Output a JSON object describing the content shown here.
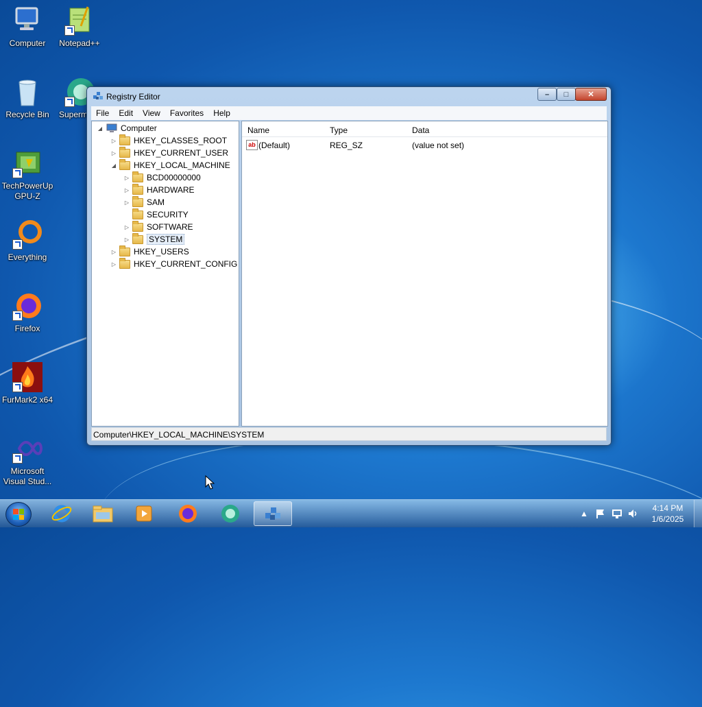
{
  "desktop": {
    "icons": [
      {
        "label": "Computer",
        "icon": "computer-icon"
      },
      {
        "label": "Notepad++",
        "icon": "notepadpp-icon"
      },
      {
        "label": "Recycle Bin",
        "icon": "recycle-bin-icon"
      },
      {
        "label": "Superm",
        "icon": "supermium-icon"
      },
      {
        "label": "TechPowerUp GPU-Z",
        "icon": "gpuz-icon"
      },
      {
        "label": "Everything",
        "icon": "everything-icon"
      },
      {
        "label": "Firefox",
        "icon": "firefox-icon"
      },
      {
        "label": "FurMark2 x64",
        "icon": "furmark-icon"
      },
      {
        "label": "Microsoft Visual Stud...",
        "icon": "visual-studio-icon"
      }
    ]
  },
  "window": {
    "title": "Registry Editor",
    "menu": [
      "File",
      "Edit",
      "View",
      "Favorites",
      "Help"
    ],
    "buttons": {
      "minimize": "–",
      "maximize": "□",
      "close": "✕"
    },
    "tree": {
      "root": "Computer",
      "nodes": [
        {
          "label": "HKEY_CLASSES_ROOT",
          "expander": "▷"
        },
        {
          "label": "HKEY_CURRENT_USER",
          "expander": "▷"
        },
        {
          "label": "HKEY_LOCAL_MACHINE",
          "expander": "◢"
        },
        {
          "label": "BCD00000000",
          "expander": "▷"
        },
        {
          "label": "HARDWARE",
          "expander": "▷"
        },
        {
          "label": "SAM",
          "expander": "▷"
        },
        {
          "label": "SECURITY",
          "expander": ""
        },
        {
          "label": "SOFTWARE",
          "expander": "▷"
        },
        {
          "label": "SYSTEM",
          "expander": "▷"
        },
        {
          "label": "HKEY_USERS",
          "expander": "▷"
        },
        {
          "label": "HKEY_CURRENT_CONFIG",
          "expander": "▷"
        }
      ],
      "root_expander": "◢"
    },
    "list": {
      "columns": [
        "Name",
        "Type",
        "Data"
      ],
      "rows": [
        {
          "name": "(Default)",
          "type": "REG_SZ",
          "data": "(value not set)",
          "icon_text": "ab"
        }
      ]
    },
    "status": "Computer\\HKEY_LOCAL_MACHINE\\SYSTEM"
  },
  "taskbar": {
    "apps": [
      "start-button",
      "internet-explorer-icon",
      "file-explorer-icon",
      "media-player-icon",
      "firefox-icon",
      "supermium-icon",
      "registry-editor-icon"
    ],
    "tray_arrow": "▲",
    "clock_time": "4:14 PM",
    "clock_date": "1/6/2025"
  }
}
